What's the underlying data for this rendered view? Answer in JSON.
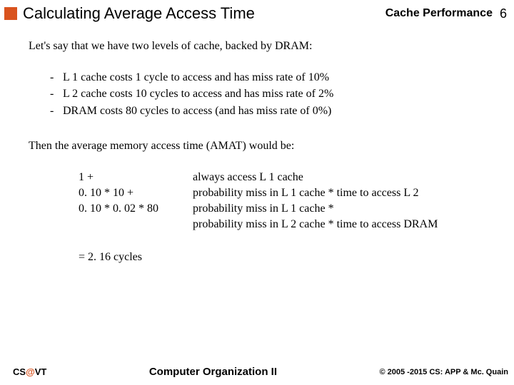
{
  "header": {
    "title": "Calculating Average Access Time",
    "topic": "Cache Performance",
    "page": "6"
  },
  "intro": "Let's say that we have two levels of cache, backed by DRAM:",
  "bullets": [
    "L 1 cache costs 1 cycle to access and has miss rate of 10%",
    "L 2 cache costs 10 cycles to access and has miss rate of 2%",
    "DRAM costs 80 cycles to access (and has miss rate of 0%)"
  ],
  "then": "Then the average memory access time (AMAT) would be:",
  "calc": {
    "left": [
      "1 +",
      "0. 10 * 10 +",
      "0. 10 * 0. 02 * 80",
      ""
    ],
    "right": [
      "always access L 1 cache",
      "probability miss in L 1 cache * time to access L 2",
      "probability miss in L 1 cache *",
      "probability miss in L 2 cache * time to access DRAM"
    ]
  },
  "result": "= 2. 16 cycles",
  "footer": {
    "left_pre": "CS",
    "left_at": "@",
    "left_post": "VT",
    "center": "Computer Organization II",
    "right": "© 2005 -2015 CS: APP & Mc. Quain"
  }
}
